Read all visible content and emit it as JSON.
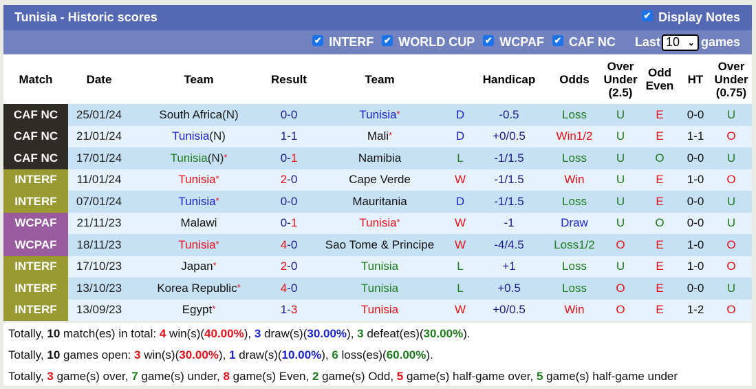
{
  "header": {
    "title": "Tunisia - Historic scores",
    "display_notes_label": "Display Notes",
    "display_notes_checked": true
  },
  "filters": {
    "items": [
      {
        "label": "INTERF",
        "checked": true
      },
      {
        "label": "WORLD CUP",
        "checked": true
      },
      {
        "label": "WCPAF",
        "checked": true
      },
      {
        "label": "CAF NC",
        "checked": true
      }
    ],
    "last_label": "Last",
    "last_value": "10",
    "games_label": "games"
  },
  "columns": {
    "match": "Match",
    "date": "Date",
    "team1": "Team",
    "result": "Result",
    "team2": "Team",
    "wl": "",
    "handicap": "Handicap",
    "odds": "Odds",
    "ou_line1": "Over",
    "ou_line2": "Under",
    "ou_line3": "(2.5)",
    "oe_line1": "Odd",
    "oe_line2": "Even",
    "ht": "HT",
    "ou2_line1": "Over",
    "ou2_line2": "Under",
    "ou2_line3": "(0.75)"
  },
  "colors": {
    "caf_nc": "#2f2b26",
    "interf": "#999a32",
    "wcpaf": "#9a5a9e",
    "red": "#e3101a",
    "blue": "#1a22c8",
    "green": "#1d7a1d"
  },
  "rows": [
    {
      "match": "CAF NC",
      "match_color": "caf_nc",
      "date": "25/01/24",
      "team1": "South Africa",
      "team1_suffix": "(N)",
      "team1_star": false,
      "team1_color": "black",
      "score_home": "0",
      "score_away": "0",
      "score_home_color": "darkblue",
      "score_away_color": "darkblue",
      "team2": "Tunisia",
      "team2_star": true,
      "team2_color": "blue",
      "wl": "D",
      "wl_color": "blue",
      "handicap": "-0.5",
      "odds": "Loss",
      "odds_color": "green",
      "ou": "U",
      "ou_color": "green",
      "oe": "E",
      "oe_color": "red",
      "ht": "0-0",
      "ou2": "U",
      "ou2_color": "green"
    },
    {
      "match": "CAF NC",
      "match_color": "caf_nc",
      "date": "21/01/24",
      "team1": "Tunisia",
      "team1_suffix": "(N)",
      "team1_star": false,
      "team1_color": "blue",
      "score_home": "1",
      "score_away": "1",
      "score_home_color": "darkblue",
      "score_away_color": "darkblue",
      "team2": "Mali",
      "team2_star": true,
      "team2_color": "black",
      "wl": "D",
      "wl_color": "blue",
      "handicap": "+0/0.5",
      "odds": "Win1/2",
      "odds_color": "red",
      "ou": "U",
      "ou_color": "green",
      "oe": "E",
      "oe_color": "red",
      "ht": "1-1",
      "ou2": "O",
      "ou2_color": "red"
    },
    {
      "match": "CAF NC",
      "match_color": "caf_nc",
      "date": "17/01/24",
      "team1": "Tunisia",
      "team1_suffix": "(N)",
      "team1_star": true,
      "team1_color": "green",
      "score_home": "0",
      "score_away": "1",
      "score_home_color": "darkblue",
      "score_away_color": "red",
      "team2": "Namibia",
      "team2_star": false,
      "team2_color": "black",
      "wl": "L",
      "wl_color": "green",
      "handicap": "-1/1.5",
      "odds": "Loss",
      "odds_color": "green",
      "ou": "U",
      "ou_color": "green",
      "oe": "O",
      "oe_color": "green",
      "ht": "0-0",
      "ou2": "U",
      "ou2_color": "green"
    },
    {
      "match": "INTERF",
      "match_color": "interf",
      "date": "11/01/24",
      "team1": "Tunisia",
      "team1_suffix": "",
      "team1_star": true,
      "team1_color": "red",
      "score_home": "2",
      "score_away": "0",
      "score_home_color": "red",
      "score_away_color": "darkblue",
      "team2": "Cape Verde",
      "team2_star": false,
      "team2_color": "black",
      "wl": "W",
      "wl_color": "red",
      "handicap": "-1/1.5",
      "odds": "Win",
      "odds_color": "red",
      "ou": "U",
      "ou_color": "green",
      "oe": "E",
      "oe_color": "red",
      "ht": "1-0",
      "ou2": "O",
      "ou2_color": "red"
    },
    {
      "match": "INTERF",
      "match_color": "interf",
      "date": "07/01/24",
      "team1": "Tunisia",
      "team1_suffix": "",
      "team1_star": true,
      "team1_color": "blue",
      "score_home": "0",
      "score_away": "0",
      "score_home_color": "darkblue",
      "score_away_color": "darkblue",
      "team2": "Mauritania",
      "team2_star": false,
      "team2_color": "black",
      "wl": "D",
      "wl_color": "blue",
      "handicap": "-1/1.5",
      "odds": "Loss",
      "odds_color": "green",
      "ou": "U",
      "ou_color": "green",
      "oe": "E",
      "oe_color": "red",
      "ht": "0-0",
      "ou2": "U",
      "ou2_color": "green"
    },
    {
      "match": "WCPAF",
      "match_color": "wcpaf",
      "date": "21/11/23",
      "team1": "Malawi",
      "team1_suffix": "",
      "team1_star": false,
      "team1_color": "black",
      "score_home": "0",
      "score_away": "1",
      "score_home_color": "darkblue",
      "score_away_color": "red",
      "team2": "Tunisia",
      "team2_star": true,
      "team2_color": "red",
      "wl": "W",
      "wl_color": "red",
      "handicap": "-1",
      "odds": "Draw",
      "odds_color": "blue",
      "ou": "U",
      "ou_color": "green",
      "oe": "O",
      "oe_color": "green",
      "ht": "0-0",
      "ou2": "U",
      "ou2_color": "green"
    },
    {
      "match": "WCPAF",
      "match_color": "wcpaf",
      "date": "18/11/23",
      "team1": "Tunisia",
      "team1_suffix": "",
      "team1_star": true,
      "team1_color": "red",
      "score_home": "4",
      "score_away": "0",
      "score_home_color": "red",
      "score_away_color": "darkblue",
      "team2": "Sao Tome & Principe",
      "team2_star": false,
      "team2_color": "black",
      "wl": "W",
      "wl_color": "red",
      "handicap": "-4/4.5",
      "odds": "Loss1/2",
      "odds_color": "green",
      "ou": "O",
      "ou_color": "red",
      "oe": "E",
      "oe_color": "red",
      "ht": "1-0",
      "ou2": "O",
      "ou2_color": "red"
    },
    {
      "match": "INTERF",
      "match_color": "interf",
      "date": "17/10/23",
      "team1": "Japan",
      "team1_suffix": "",
      "team1_star": true,
      "team1_color": "black",
      "score_home": "2",
      "score_away": "0",
      "score_home_color": "red",
      "score_away_color": "darkblue",
      "team2": "Tunisia",
      "team2_star": false,
      "team2_color": "green",
      "wl": "L",
      "wl_color": "green",
      "handicap": "+1",
      "odds": "Loss",
      "odds_color": "green",
      "ou": "U",
      "ou_color": "green",
      "oe": "E",
      "oe_color": "red",
      "ht": "1-0",
      "ou2": "O",
      "ou2_color": "red"
    },
    {
      "match": "INTERF",
      "match_color": "interf",
      "date": "13/10/23",
      "team1": "Korea Republic",
      "team1_suffix": "",
      "team1_star": true,
      "team1_color": "black",
      "score_home": "4",
      "score_away": "0",
      "score_home_color": "red",
      "score_away_color": "darkblue",
      "team2": "Tunisia",
      "team2_star": false,
      "team2_color": "green",
      "wl": "L",
      "wl_color": "green",
      "handicap": "+0.5",
      "odds": "Loss",
      "odds_color": "green",
      "ou": "O",
      "ou_color": "red",
      "oe": "E",
      "oe_color": "red",
      "ht": "0-0",
      "ou2": "U",
      "ou2_color": "green"
    },
    {
      "match": "INTERF",
      "match_color": "interf",
      "date": "13/09/23",
      "team1": "Egypt",
      "team1_suffix": "",
      "team1_star": true,
      "team1_color": "black",
      "score_home": "1",
      "score_away": "3",
      "score_home_color": "darkblue",
      "score_away_color": "red",
      "team2": "Tunisia",
      "team2_star": false,
      "team2_color": "red",
      "wl": "W",
      "wl_color": "red",
      "handicap": "+0/0.5",
      "odds": "Win",
      "odds_color": "red",
      "ou": "O",
      "ou_color": "red",
      "oe": "E",
      "oe_color": "red",
      "ht": "1-2",
      "ou2": "O",
      "ou2_color": "red"
    }
  ],
  "summary": {
    "line1": [
      {
        "t": "Totally, "
      },
      {
        "t": "10",
        "c": "black",
        "b": true
      },
      {
        "t": " match(es) in total: "
      },
      {
        "t": "4",
        "c": "red",
        "b": true
      },
      {
        "t": " win(s)("
      },
      {
        "t": "40.00%",
        "c": "red",
        "b": true
      },
      {
        "t": "), "
      },
      {
        "t": "3",
        "c": "blue",
        "b": true
      },
      {
        "t": " draw(s)("
      },
      {
        "t": "30.00%",
        "c": "blue",
        "b": true
      },
      {
        "t": "), "
      },
      {
        "t": "3",
        "c": "green",
        "b": true
      },
      {
        "t": " defeat(es)("
      },
      {
        "t": "30.00%",
        "c": "green",
        "b": true
      },
      {
        "t": ")."
      }
    ],
    "line2": [
      {
        "t": "Totally, "
      },
      {
        "t": "10",
        "c": "black",
        "b": true
      },
      {
        "t": " games open: "
      },
      {
        "t": "3",
        "c": "red",
        "b": true
      },
      {
        "t": " win(s)("
      },
      {
        "t": "30.00%",
        "c": "red",
        "b": true
      },
      {
        "t": "), "
      },
      {
        "t": "1",
        "c": "blue",
        "b": true
      },
      {
        "t": " draw(s)("
      },
      {
        "t": "10.00%",
        "c": "blue",
        "b": true
      },
      {
        "t": "), "
      },
      {
        "t": "6",
        "c": "green",
        "b": true
      },
      {
        "t": " loss(es)("
      },
      {
        "t": "60.00%",
        "c": "green",
        "b": true
      },
      {
        "t": ")."
      }
    ],
    "line3": [
      {
        "t": "Totally, "
      },
      {
        "t": "3",
        "c": "red",
        "b": true
      },
      {
        "t": " game(s) over, "
      },
      {
        "t": "7",
        "c": "green",
        "b": true
      },
      {
        "t": " game(s) under, "
      },
      {
        "t": "8",
        "c": "red",
        "b": true
      },
      {
        "t": " game(s) Even, "
      },
      {
        "t": "2",
        "c": "green",
        "b": true
      },
      {
        "t": " game(s) Odd, "
      },
      {
        "t": "5",
        "c": "red",
        "b": true
      },
      {
        "t": " game(s) half-game over, "
      },
      {
        "t": "5",
        "c": "green",
        "b": true
      },
      {
        "t": " game(s) half-game under"
      }
    ]
  }
}
